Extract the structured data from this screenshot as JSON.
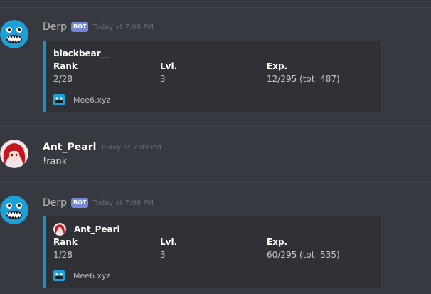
{
  "messages": [
    {
      "author": "Derp",
      "bot_tag": "BOT",
      "timestamp": "Today at 7:09 PM",
      "avatar_icon": "mee6-monster-avatar",
      "embed": {
        "author": "blackbear__",
        "fields": [
          {
            "name": "Rank",
            "value": "2/28"
          },
          {
            "name": "Lvl.",
            "value": "3"
          },
          {
            "name": "Exp.",
            "value": "12/295 (tot. 487)"
          }
        ],
        "footer": "Mee6.xyz",
        "accent_color": "#1e90c8"
      }
    },
    {
      "author": "Ant_Pearl",
      "timestamp": "Today at 7:09 PM",
      "avatar_icon": "anime-red-hair-avatar",
      "text": "!rank"
    },
    {
      "author": "Derp",
      "bot_tag": "BOT",
      "timestamp": "Today at 7:09 PM",
      "avatar_icon": "mee6-monster-avatar",
      "embed": {
        "author": "Ant_Pearl",
        "fields": [
          {
            "name": "Rank",
            "value": "1/28"
          },
          {
            "name": "Lvl.",
            "value": "3"
          },
          {
            "name": "Exp.",
            "value": "60/295 (tot. 535)"
          }
        ],
        "footer": "Mee6.xyz",
        "accent_color": "#1e90c8"
      }
    }
  ],
  "colors": {
    "background": "#36393f",
    "embed_background": "#2f3136",
    "bot_tag": "#7289da",
    "timestamp": "#6a6d73"
  }
}
